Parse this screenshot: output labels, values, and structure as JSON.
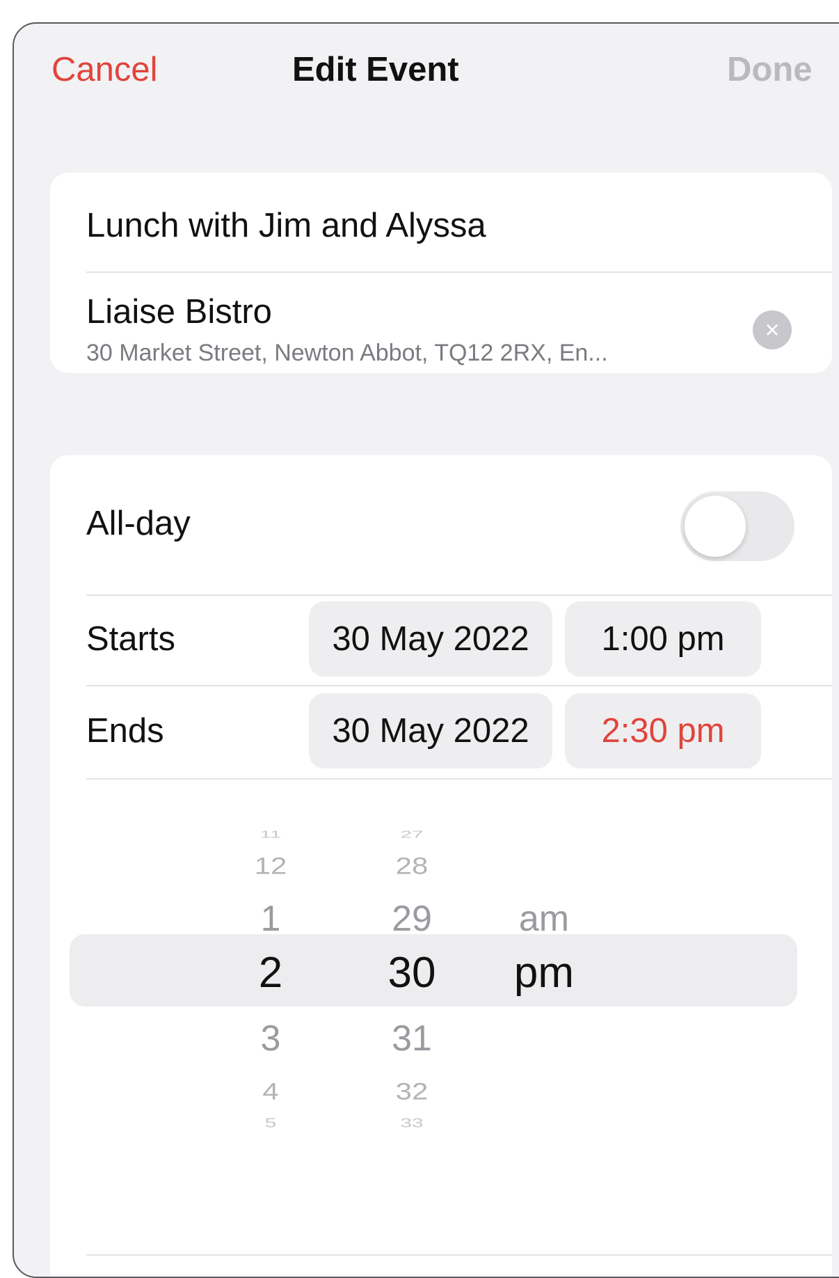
{
  "nav": {
    "cancel_label": "Cancel",
    "title": "Edit Event",
    "done_label": "Done"
  },
  "event": {
    "title": "Lunch with Jim and Alyssa",
    "location_name": "Liaise Bistro",
    "location_address": "30 Market Street, Newton Abbot, TQ12 2RX, En...",
    "clear_icon": "×"
  },
  "allday": {
    "label": "All-day",
    "enabled": false
  },
  "starts": {
    "label": "Starts",
    "date": "30 May 2022",
    "time": "1:00 pm"
  },
  "ends": {
    "label": "Ends",
    "date": "30 May 2022",
    "time": "2:30 pm"
  },
  "picker": {
    "hours": [
      "11",
      "12",
      "1",
      "2",
      "3",
      "4",
      "5"
    ],
    "minutes": [
      "27",
      "28",
      "29",
      "30",
      "31",
      "32",
      "33"
    ],
    "periods": [
      "am",
      "pm"
    ],
    "selected": {
      "hour": "2",
      "minute": "30",
      "period": "pm"
    }
  },
  "colors": {
    "accent": "#e0443c",
    "disabled": "#b9b9be",
    "background": "#f2f2f4"
  }
}
